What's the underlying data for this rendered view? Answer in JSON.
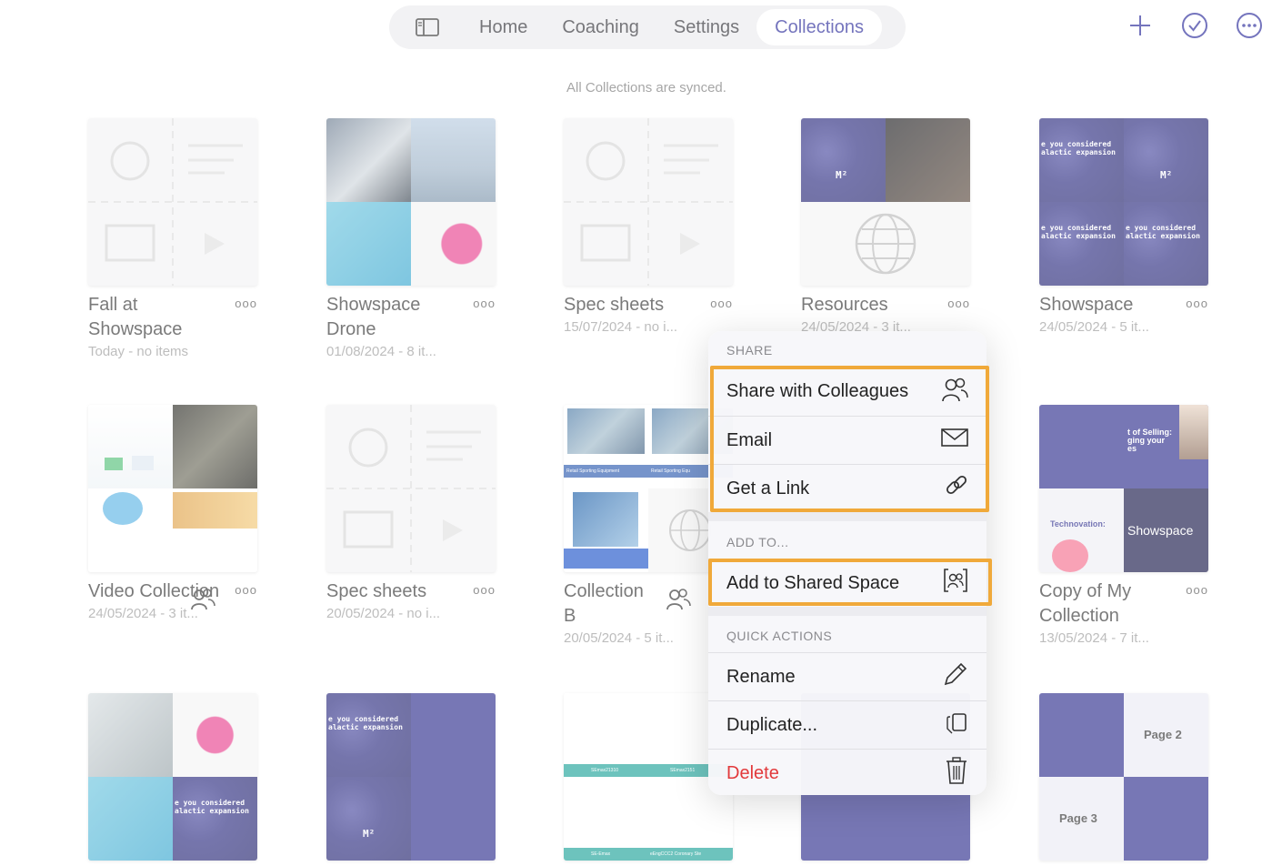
{
  "nav": {
    "tabs": [
      {
        "label": "Home"
      },
      {
        "label": "Coaching"
      },
      {
        "label": "Settings"
      },
      {
        "label": "Collections"
      }
    ],
    "active": "Collections",
    "accent": "#2a2a9a"
  },
  "status_text": "All Collections are synced.",
  "tiles": [
    {
      "name": "Fall at Showspace",
      "meta": "Today - no items"
    },
    {
      "name": "Showspace Drone",
      "meta": "01/08/2024 - 8 it..."
    },
    {
      "name": "Spec sheets",
      "meta": "15/07/2024 - no i..."
    },
    {
      "name": "Resources",
      "meta": "24/05/2024 - 3 it..."
    },
    {
      "name": "Showspace",
      "meta": "24/05/2024 - 5 it..."
    },
    {
      "name": "Video Collection",
      "meta": "24/05/2024 - 3 it..."
    },
    {
      "name": "Spec sheets",
      "meta": "20/05/2024 - no i..."
    },
    {
      "name": "Collection B",
      "meta": "20/05/2024 - 5 it..."
    },
    {
      "name": "Copy of My Collection",
      "meta": "13/05/2024 - 7 it..."
    }
  ],
  "thumb_text": {
    "space1": "e you considered alactic expansion",
    "m2": "M²",
    "retail": "Retail Sporting Equipment",
    "retail2": "Retail Sporting Equ",
    "technovation": "Technovation:",
    "selling": "t of Selling: ging your es",
    "showspace": "Showspace",
    "page2": "Page 2",
    "page3": "Page 3",
    "se1": "SEmax21310",
    "se2": "SEmax2151",
    "se3": "SE-Emax",
    "se4": "eEngCCC2 Coronary Ste"
  },
  "menu": {
    "share_header": "SHARE",
    "share_colleagues": "Share with Colleagues",
    "email": "Email",
    "get_link": "Get a Link",
    "add_header": "ADD TO...",
    "add_shared": "Add to Shared Space",
    "quick_header": "QUICK ACTIONS",
    "rename": "Rename",
    "duplicate": "Duplicate...",
    "delete": "Delete",
    "delete_color": "#e2393b",
    "highlight_color": "#f0a93a"
  }
}
